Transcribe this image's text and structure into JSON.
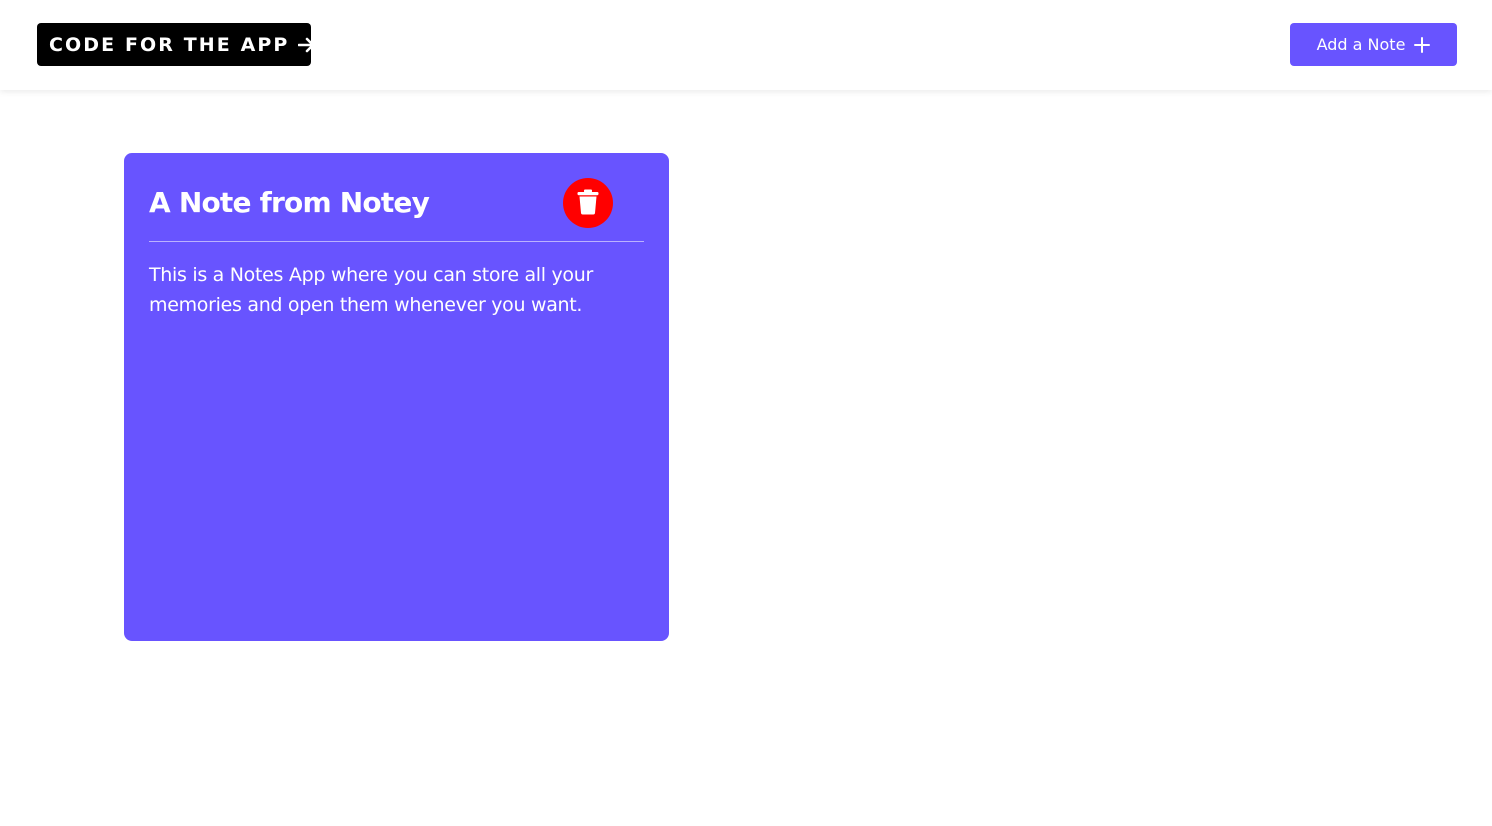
{
  "header": {
    "code_link_label": "CODE FOR THE APP",
    "code_link_icon": "arrow-right-icon",
    "add_button_label": "Add a Note",
    "add_button_icon": "plus-icon"
  },
  "notes": [
    {
      "title": "A Note from Notey",
      "body": "This is a Notes App where you can store all your memories and open them whenever you want.",
      "delete_icon": "trash-icon"
    }
  ],
  "colors": {
    "accent": "#6854ff",
    "delete": "#ff0000",
    "code_link_bg": "#000000",
    "text_on_accent": "#ffffff"
  }
}
